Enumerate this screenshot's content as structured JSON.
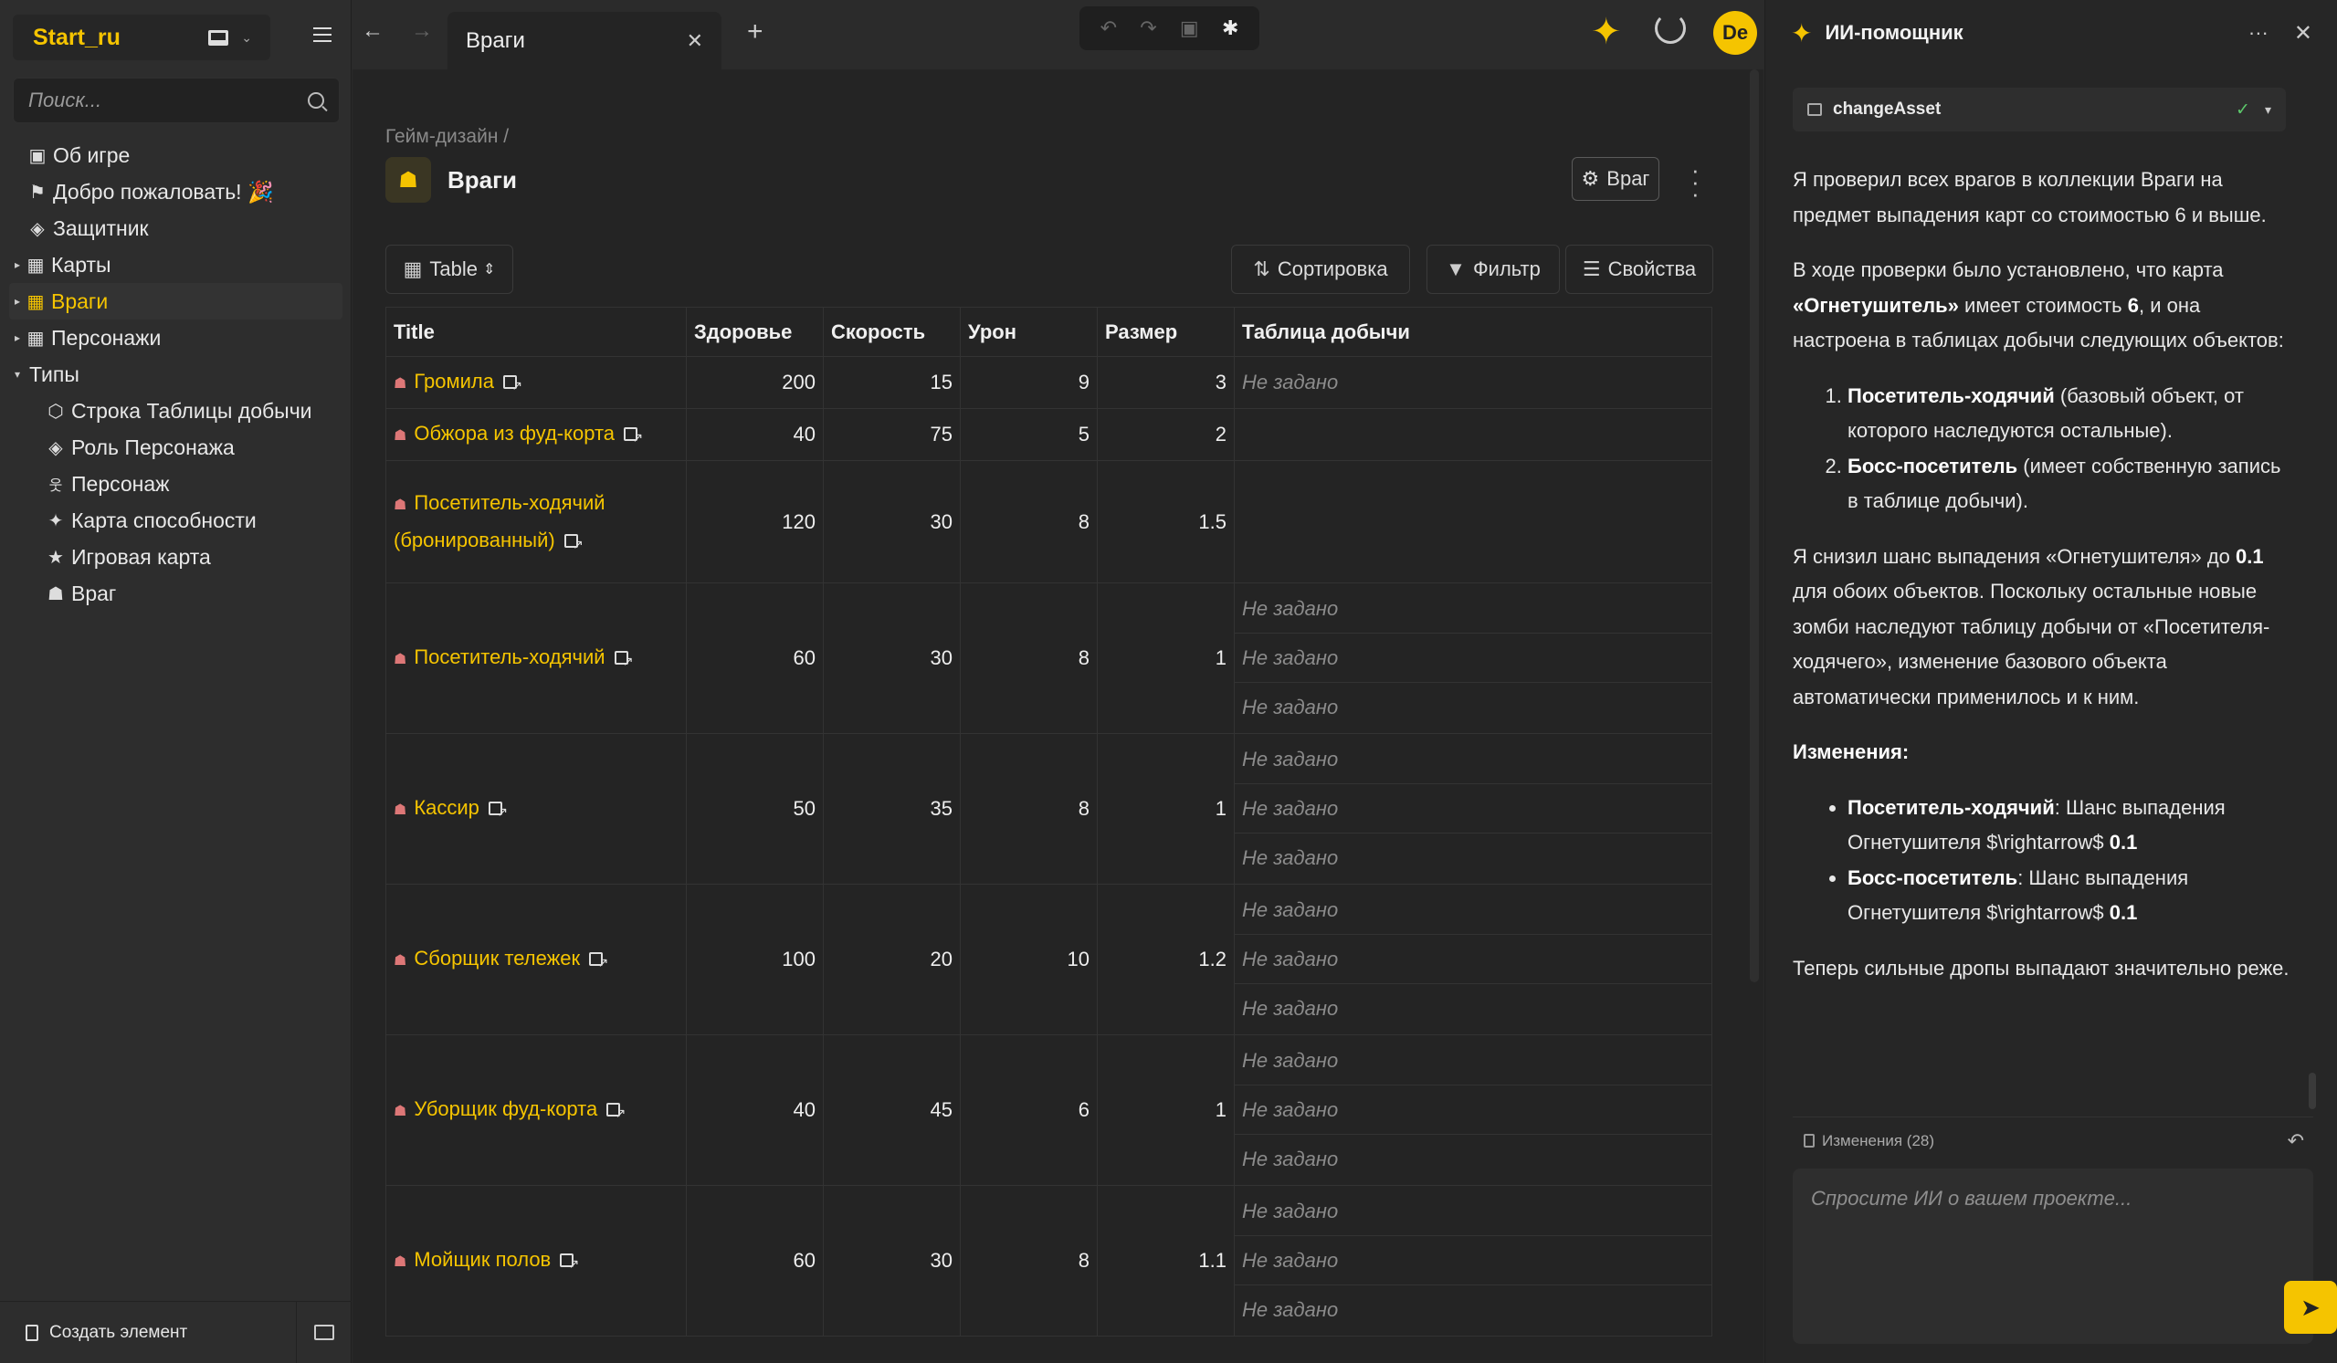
{
  "sidebar": {
    "workspace_name": "Start_ru",
    "search_placeholder": "Поиск...",
    "items": [
      {
        "label": "Об игре",
        "icon": "id-card-icon",
        "glyph": "▣"
      },
      {
        "label": "Добро пожаловать! 🎉",
        "icon": "flag-icon",
        "glyph": "⚑"
      },
      {
        "label": "Защитник",
        "icon": "layers-icon",
        "glyph": "◈"
      },
      {
        "label": "Карты",
        "icon": "table-icon",
        "glyph": "▦"
      },
      {
        "label": "Враги",
        "icon": "table-icon",
        "glyph": "▦"
      },
      {
        "label": "Персонажи",
        "icon": "table-icon",
        "glyph": "▦"
      },
      {
        "label": "Типы",
        "icon": "",
        "glyph": ""
      },
      {
        "label": "Строка Таблицы добычи",
        "icon": "cube-icon",
        "glyph": "⬡"
      },
      {
        "label": "Роль Персонажа",
        "icon": "layers-icon",
        "glyph": "◈"
      },
      {
        "label": "Персонаж",
        "icon": "person-icon",
        "glyph": "웃"
      },
      {
        "label": "Карта способности",
        "icon": "sparkles-icon",
        "glyph": "✦"
      },
      {
        "label": "Игровая карта",
        "icon": "star-icon",
        "glyph": "★"
      },
      {
        "label": "Враг",
        "icon": "enemy-icon",
        "glyph": "☗"
      }
    ],
    "create_label": "Создать элемент"
  },
  "topbar": {
    "tab_title": "Враги",
    "back_glyph": "←",
    "forward_glyph": "→",
    "close_glyph": "✕",
    "plus_glyph": "+",
    "avatar_initials": "De",
    "accent": "#f5c400"
  },
  "page": {
    "breadcrumb": "Гейм-дизайн /",
    "title": "Враги",
    "type_button": "Враг",
    "view_label": "Table",
    "sort_label": "Сортировка",
    "filter_label": "Фильтр",
    "props_label": "Свойства"
  },
  "table": {
    "columns": [
      "Title",
      "Здоровье",
      "Скорость",
      "Урон",
      "Размер",
      "Таблица добычи"
    ],
    "empty_text": "Не задано",
    "rows": [
      {
        "title": "Громила",
        "hp": "200",
        "speed": "15",
        "dmg": "9",
        "size": "3",
        "loot": [
          "Не задано"
        ]
      },
      {
        "title": "Обжора из фуд-корта",
        "hp": "40",
        "speed": "75",
        "dmg": "5",
        "size": "2",
        "loot": []
      },
      {
        "title": "Посетитель-ходячий (бронированный)",
        "hp": "120",
        "speed": "30",
        "dmg": "8",
        "size": "1.5",
        "loot": []
      },
      {
        "title": "Посетитель-ходячий",
        "hp": "60",
        "speed": "30",
        "dmg": "8",
        "size": "1",
        "loot": [
          "Не задано",
          "Не задано",
          "Не задано"
        ]
      },
      {
        "title": "Кассир",
        "hp": "50",
        "speed": "35",
        "dmg": "8",
        "size": "1",
        "loot": [
          "Не задано",
          "Не задано",
          "Не задано"
        ]
      },
      {
        "title": "Сборщик тележек",
        "hp": "100",
        "speed": "20",
        "dmg": "10",
        "size": "1.2",
        "loot": [
          "Не задано",
          "Не задано",
          "Не задано"
        ]
      },
      {
        "title": "Уборщик фуд-корта",
        "hp": "40",
        "speed": "45",
        "dmg": "6",
        "size": "1",
        "loot": [
          "Не задано",
          "Не задано",
          "Не задано"
        ]
      },
      {
        "title": "Мойщик полов",
        "hp": "60",
        "speed": "30",
        "dmg": "8",
        "size": "1.1",
        "loot": [
          "Не задано",
          "Не задано",
          "Не задано"
        ]
      }
    ]
  },
  "ai": {
    "title": "ИИ-помощник",
    "tool_name": "changeAsset",
    "p1": "Я проверил всех врагов в коллекции Враги на предмет выпадения карт со стоимостью 6 и выше.",
    "p2_a": "В ходе проверки было установлено, что карта ",
    "p2_b": "«Огнетушитель»",
    "p2_c": " имеет стоимость ",
    "p2_d": "6",
    "p2_e": ", и она настроена в таблицах добычи следующих объектов:",
    "ol1_b": "Посетитель-ходячий",
    "ol1_t": " (базовый объект, от которого наследуются остальные).",
    "ol2_b": "Босс-посетитель",
    "ol2_t": " (имеет собственную запись в таблице добычи).",
    "p3_a": "Я снизил шанс выпадения «Огнетушителя» до ",
    "p3_b": "0.1",
    "p3_c": " для обоих объектов. Поскольку остальные новые зомби наследуют таблицу добычи от «Посетителя-ходячего», изменение базового объекта автоматически применилось и к ним.",
    "changes_heading": "Изменения:",
    "ul1_b": "Посетитель-ходячий",
    "ul1_t": ": Шанс выпадения Огнетушителя $\\rightarrow$ ",
    "ul1_v": "0.1",
    "ul2_b": "Босс-посетитель",
    "ul2_t": ": Шанс выпадения Огнетушителя $\\rightarrow$ ",
    "ul2_v": "0.1",
    "p4": "Теперь сильные дропы выпадают значительно реже.",
    "changes_label": "Изменения (28)",
    "input_placeholder": "Спросите ИИ о вашем проекте..."
  }
}
